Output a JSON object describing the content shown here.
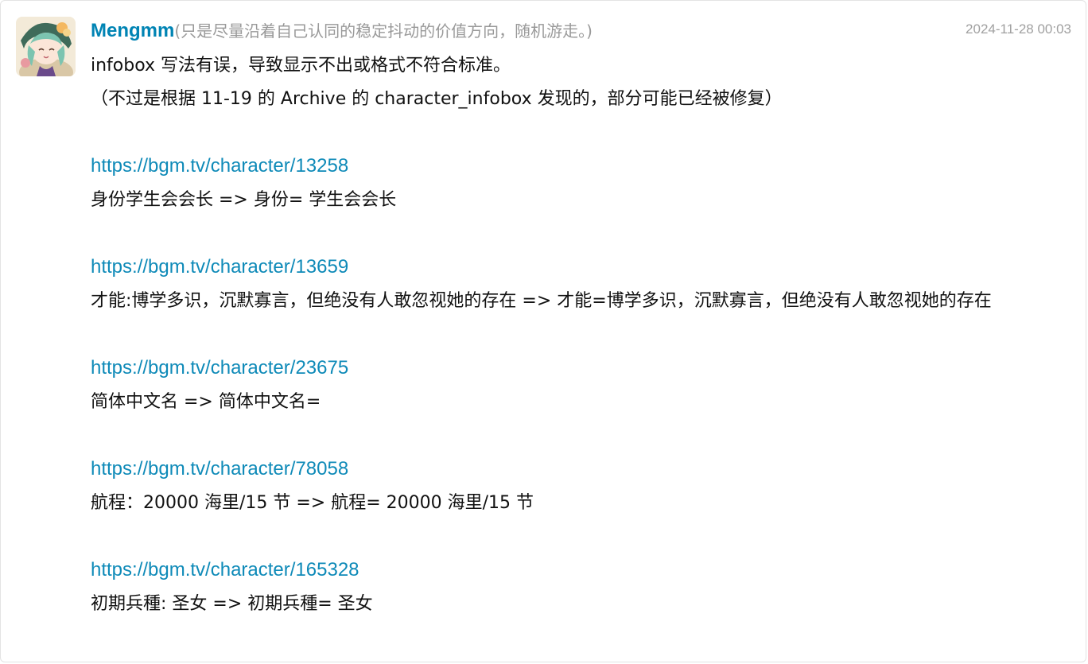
{
  "post": {
    "username": "Mengmm",
    "signature": "(只是尽量沿着自己认同的稳定抖动的价值方向，随机游走。)",
    "timestamp": "2024-11-28 00:03",
    "intro_line1": "infobox 写法有误，导致显示不出或格式不符合标准。",
    "intro_line2": "（不过是根据 11-19 的 Archive 的 character_infobox 发现的，部分可能已经被修复）",
    "entries": [
      {
        "url": "https://bgm.tv/character/13258",
        "fix": "身份学生会会长 => 身份= 学生会会长"
      },
      {
        "url": "https://bgm.tv/character/13659",
        "fix": "才能:博学多识，沉默寡言，但绝没有人敢忽视她的存在 => 才能=博学多识，沉默寡言，但绝没有人敢忽视她的存在"
      },
      {
        "url": "https://bgm.tv/character/23675",
        "fix": "简体中文名 => 简体中文名="
      },
      {
        "url": "https://bgm.tv/character/78058",
        "fix": "航程：20000 海里/15 节 => 航程= 20000 海里/15 节"
      },
      {
        "url": "https://bgm.tv/character/165328",
        "fix": "初期兵種: 圣女 => 初期兵種= 圣女"
      }
    ]
  },
  "colors": {
    "username": "#0084b4",
    "link": "#0e8ab8",
    "muted": "#999999",
    "text": "#111111"
  },
  "icons": {
    "avatar": "anime-character-avatar"
  }
}
